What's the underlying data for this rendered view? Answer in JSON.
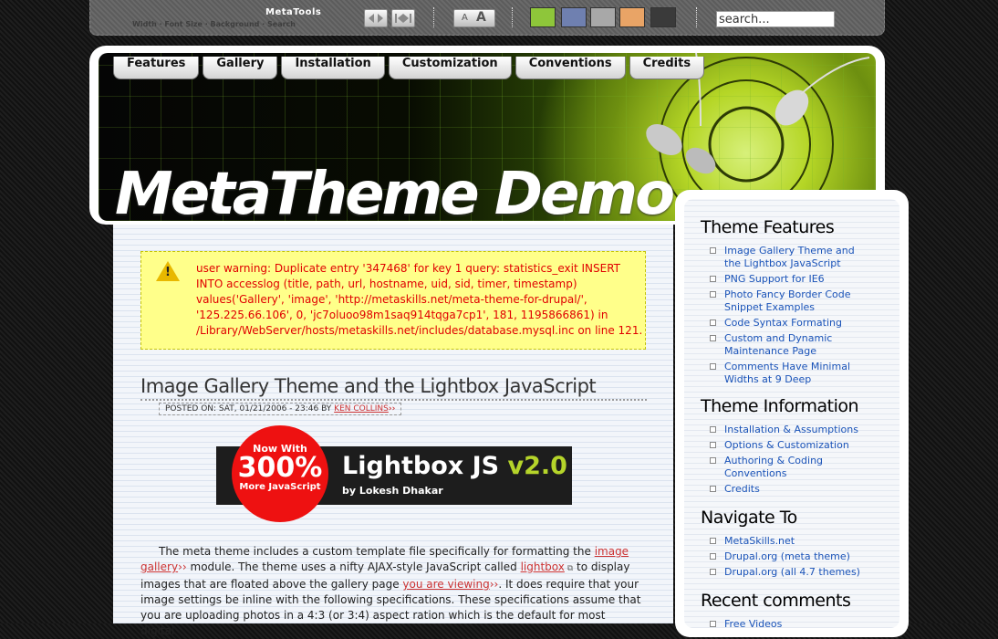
{
  "metatools": {
    "title": "MetaTools",
    "subtitle": "Width · Font Size · Background · Search",
    "font_small": "A",
    "font_large": "A",
    "search_value": "search...",
    "swatches": [
      "#8ec63a",
      "#6f80b0",
      "#a8a8a8",
      "#e9a466",
      "#3a3a3a"
    ]
  },
  "nav": {
    "tabs": [
      "Features",
      "Gallery",
      "Installation",
      "Customization",
      "Conventions",
      "Credits"
    ]
  },
  "site": {
    "name": "MetaTheme Demo"
  },
  "warning": {
    "text": "user warning: Duplicate entry '347468' for key 1 query: statistics_exit INSERT INTO accesslog (title, path, url, hostname, uid, sid, timer, timestamp) values('Gallery', 'image', 'http://metaskills.net/meta-theme-for-drupal/', '125.225.66.106', 0, 'jc7oluoo98m1saq914tqga7cp1', 181, 1195866861) in /Library/WebServer/hosts/metaskills.net/includes/database.mysql.inc on line 121."
  },
  "post": {
    "title": "Image Gallery Theme and the Lightbox JavaScript",
    "meta_prefix": "POSTED ON: SAT, 01/21/2006 - 23:46 BY",
    "author": "KEN COLLINS",
    "image": {
      "badge_top": "Now With",
      "badge_big": "300%",
      "badge_bottom": "More JavaScript",
      "title": "Lightbox JS",
      "version": "v2.0",
      "by": "by Lokesh Dhakar"
    },
    "body_1": "The meta theme includes a custom template file specifically for formatting the",
    "link_1": "image gallery",
    "body_2": "module. The theme uses a nifty AJAX-style JavaScript called",
    "link_2": "lightbox",
    "body_3": "to display images that are floated above the gallery page",
    "link_3": "you are viewing",
    "body_4": ". It does require that your image settings be inline with the following specifications. These specifications assume that you are uploading photos in a 4:3 (or 3:4) aspect ration which is the default for most digital"
  },
  "sidebar": {
    "features_heading": "Theme Features",
    "features": [
      "Image Gallery Theme and the Lightbox JavaScript",
      "PNG Support for IE6",
      "Photo Fancy Border Code Snippet Examples",
      "Code Syntax Formating",
      "Custom and Dynamic Maintenance Page",
      "Comments Have Minimal Widths at 9 Deep"
    ],
    "info_heading": "Theme Information",
    "info": [
      "Installation & Assumptions",
      "Options & Customization",
      "Authoring & Coding Conventions",
      "Credits"
    ],
    "navigate_heading": "Navigate To",
    "navigate": [
      "MetaSkills.net",
      "Drupal.org (meta theme)",
      "Drupal.org (all 4.7 themes)"
    ],
    "recent_heading": "Recent comments",
    "recent": [
      "Free Videos"
    ]
  }
}
